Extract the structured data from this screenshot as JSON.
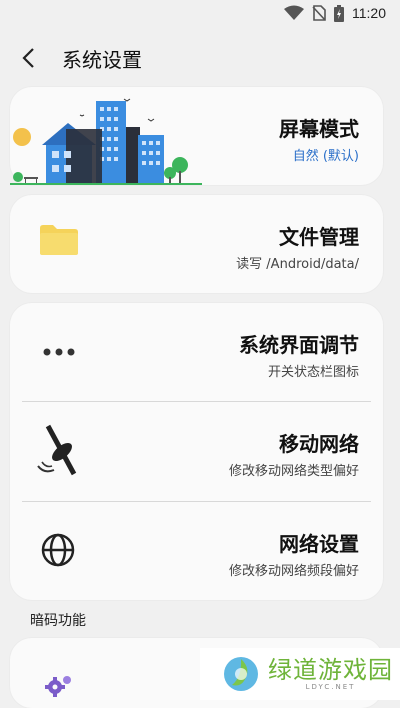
{
  "status": {
    "time": "11:20"
  },
  "header": {
    "title": "系统设置"
  },
  "cards": {
    "screen_mode": {
      "title": "屏幕模式",
      "subtitle": "自然 (默认)"
    },
    "file_manage": {
      "title": "文件管理",
      "subtitle": "读写 /Android/data/"
    },
    "system_ui": {
      "title": "系统界面调节",
      "subtitle": "开关状态栏图标"
    },
    "mobile_network": {
      "title": "移动网络",
      "subtitle": "修改移动网络类型偏好"
    },
    "network_settings": {
      "title": "网络设置",
      "subtitle": "修改移动网络频段偏好"
    }
  },
  "section": {
    "secret_code_label": "暗码功能"
  },
  "watermark": {
    "name": "绿道游戏园",
    "site": "LDYC.NET"
  },
  "colors": {
    "background": "#f0f0f0",
    "card": "#fafafa",
    "accent_blue": "#2a6fc9",
    "folder_yellow": "#f5d35a",
    "watermark_green": "#6fb43a"
  },
  "icons": [
    "back-arrow-icon",
    "wifi-icon",
    "no-sim-icon",
    "battery-icon",
    "city-illustration-icon",
    "folder-icon",
    "more-dots-icon",
    "satellite-icon",
    "globe-icon",
    "gear-icon",
    "watermark-logo-icon"
  ]
}
